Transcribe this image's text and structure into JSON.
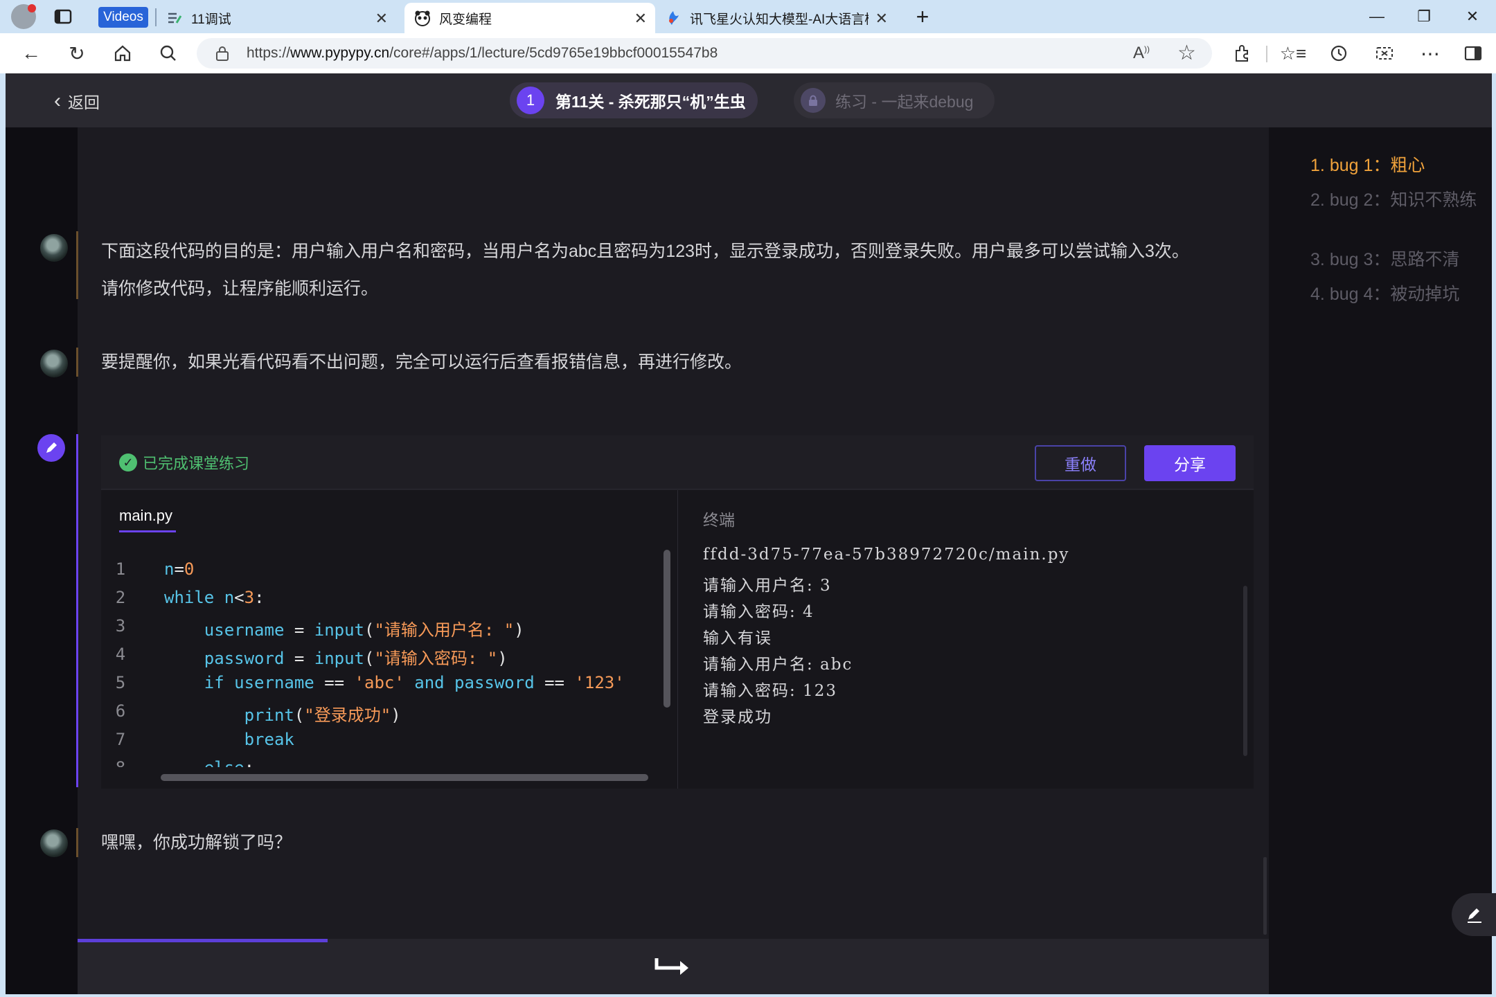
{
  "browser": {
    "tabs": [
      {
        "label": "Videos",
        "kind": "badge"
      },
      {
        "label": "11调试"
      },
      {
        "label": "风变编程",
        "active": true
      },
      {
        "label": "讯飞星火认知大模型-AI大语言模"
      }
    ],
    "url": "https://www.pypypy.cn/core#/apps/1/lecture/5cd9765e19bbcf00015547b8",
    "url_domain_bold": "www.pypypy.cn"
  },
  "header": {
    "back_label": "返回",
    "level_number": "1",
    "level_title": "第11关 - 杀死那只“机”生虫",
    "practice_title": "练习 - 一起来debug"
  },
  "messages": {
    "m1_line1": "下面这段代码的目的是：用户输入用户名和密码，当用户名为abc且密码为123时，显示登录成功，否则登录失败。用户最多可以尝试输入3次。",
    "m1_line2": "请你修改代码，让程序能顺利运行。",
    "m2": "要提醒你，如果光看代码看不出问题，完全可以运行后查看报错信息，再进行修改。",
    "m3": "嘿嘿，你成功解锁了吗？"
  },
  "exercise": {
    "status": "已完成课堂练习",
    "redo_label": "重做",
    "share_label": "分享",
    "file_tab": "main.py",
    "code_lines": [
      "n=0",
      "while n<3:",
      "    username = input(\"请输入用户名: \")",
      "    password = input(\"请输入密码: \")",
      "    if username == 'abc' and password == '123'",
      "        print(\"登录成功\")",
      "        break",
      "    else:"
    ],
    "terminal_title": "终端",
    "terminal_lines": [
      "ffdd-3d75-77ea-57b38972720c/main.py",
      "请输入用户名: 3",
      "请输入密码: 4",
      "输入有误",
      "请输入用户名: abc",
      "请输入密码: 123",
      "登录成功"
    ]
  },
  "outline": {
    "items": [
      {
        "num": "1.",
        "label": "bug 1：",
        "title": "粗心",
        "active": true
      },
      {
        "num": "2.",
        "label": "bug 2：",
        "title": "知识不熟练"
      },
      {
        "num": "3.",
        "label": "bug 3：",
        "title": "思路不清"
      },
      {
        "num": "4.",
        "label": "bug 4：",
        "title": "被动掉坑"
      }
    ]
  },
  "progress": 0.21,
  "colors": {
    "accent": "#6b43f0",
    "success": "#4fc071",
    "outline_active": "#f0a23b",
    "code_keyword": "#57c4e8",
    "code_string": "#f79a58"
  }
}
